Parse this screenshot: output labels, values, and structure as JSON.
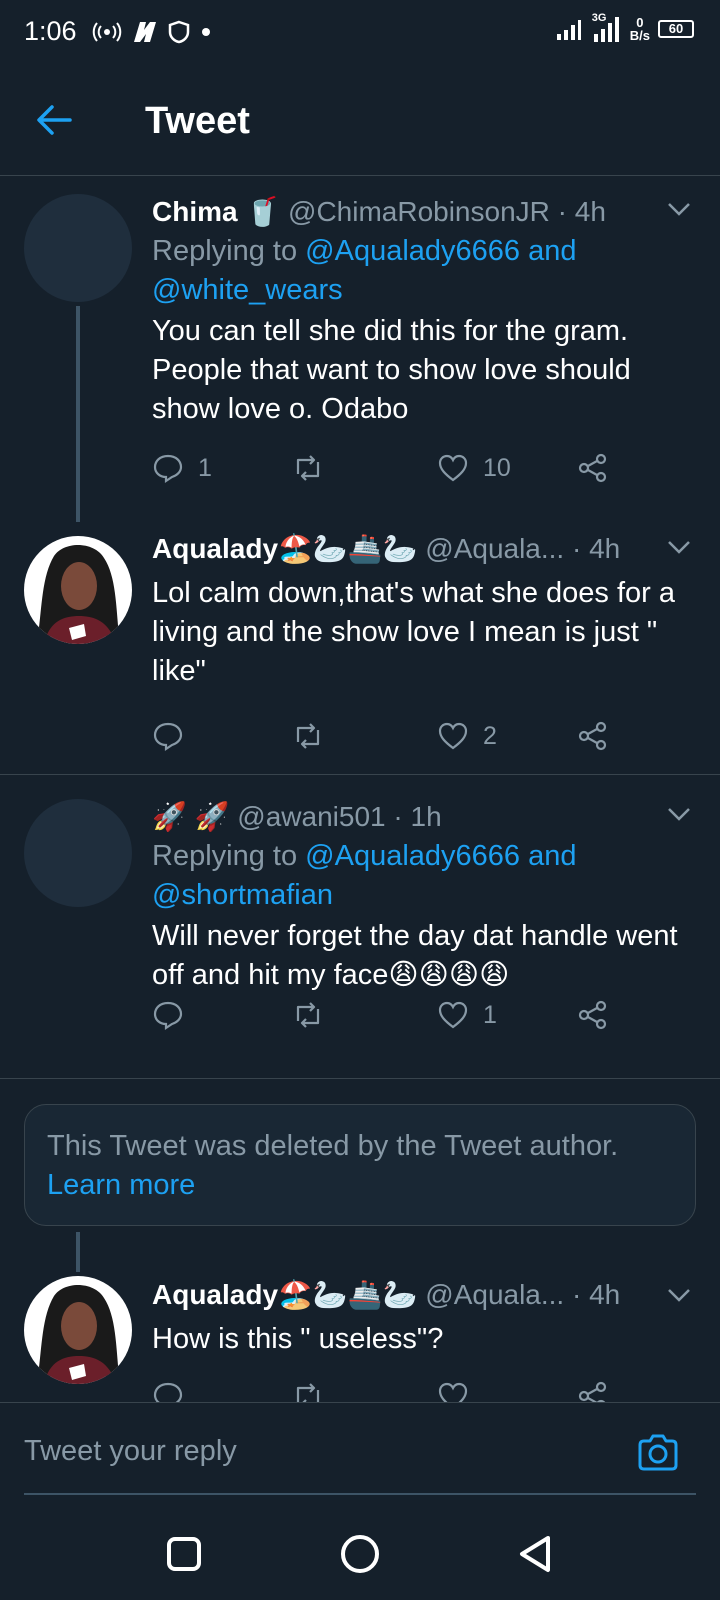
{
  "status_bar": {
    "time": "1:06",
    "net_speed_value": "0",
    "net_speed_unit": "B/s",
    "battery": "60",
    "network_label": "3G"
  },
  "header": {
    "title": "Tweet",
    "back_icon": "arrow-left-icon"
  },
  "tweets": [
    {
      "name": "Chima",
      "emoji": "🥤",
      "handle": "@ChimaRobinsonJR",
      "time": "· 4h",
      "reply_prefix": "Replying to",
      "reply_to_1": "@Aqualady6666 and",
      "reply_to_2": "@white_wears",
      "text": "You can tell she did this for the gram. People that want to show love should show love o. Odabo",
      "replies": "1",
      "retweets": "",
      "likes": "10"
    },
    {
      "name": "Aqualady",
      "emoji": "🏖️🦢🚢🦢",
      "handle": "@Aquala...",
      "time": "· 4h",
      "text": "Lol calm down,that's what she does for a living and the show love I mean is just \" like\"",
      "replies": "",
      "retweets": "",
      "likes": "2"
    },
    {
      "name": "",
      "emoji": "🚀 🚀",
      "handle": "@awani501",
      "time": "· 1h",
      "reply_prefix": "Replying to",
      "reply_to_1": "@Aqualady6666 and",
      "reply_to_2": "@shortmafian",
      "text": "Will never forget the day dat handle went off and hit my face😩😩😩😩",
      "replies": "",
      "retweets": "",
      "likes": "1"
    },
    {
      "name": "Aqualady",
      "emoji": "🏖️🦢🚢🦢",
      "handle": "@Aquala...",
      "time": "· 4h",
      "text": "How is this \" useless\"?"
    }
  ],
  "deleted_notice": {
    "text": "This Tweet was deleted by the Tweet author.",
    "link": "Learn more"
  },
  "reply_bar": {
    "placeholder": "Tweet your reply",
    "camera_icon": "camera-icon"
  },
  "colors": {
    "background": "#15202b",
    "accent": "#1da1f2",
    "muted": "#8899a6",
    "border": "#38444d"
  }
}
